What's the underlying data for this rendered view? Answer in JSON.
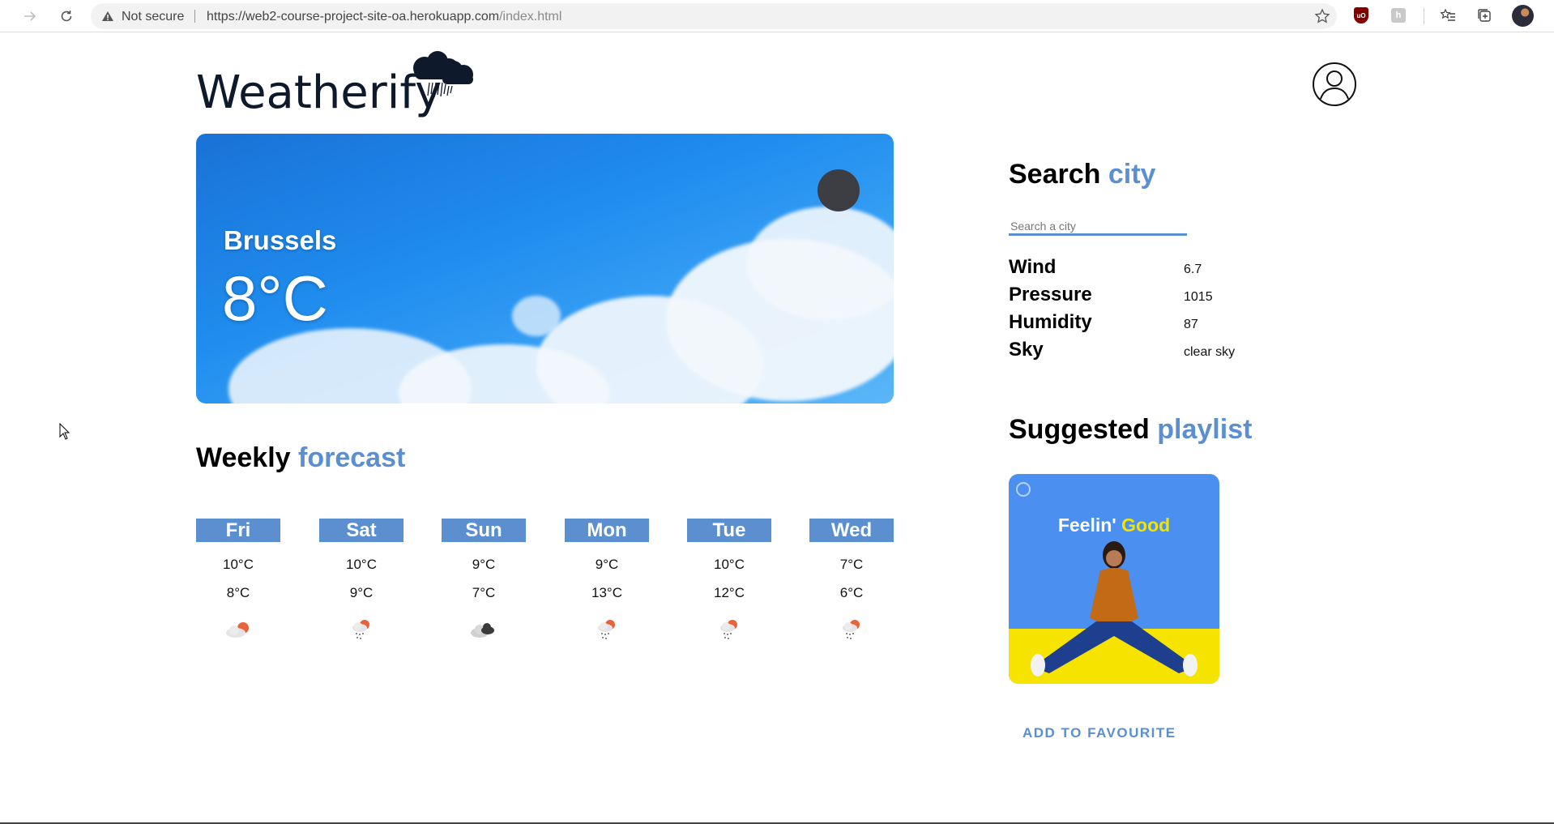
{
  "browser": {
    "security_label": "Not secure",
    "url_host": "https://web2-course-project-site-oa.herokuapp.com",
    "url_path": "/index.html",
    "ublock_badge": "uO",
    "gray_ext_badge": "h"
  },
  "logo": {
    "text": "Weatherify"
  },
  "hero": {
    "city": "Brussels",
    "temperature": "8°C"
  },
  "weekly": {
    "title_main": "Weekly",
    "title_accent": "forecast",
    "days": [
      {
        "day": "Fri",
        "high": "10°C",
        "low": "8°C",
        "icon": "cloud-sun-icon"
      },
      {
        "day": "Sat",
        "high": "10°C",
        "low": "9°C",
        "icon": "cloud-rain-sun-icon"
      },
      {
        "day": "Sun",
        "high": "9°C",
        "low": "7°C",
        "icon": "dark-clouds-icon"
      },
      {
        "day": "Mon",
        "high": "9°C",
        "low": "13°C",
        "icon": "cloud-rain-sun-icon"
      },
      {
        "day": "Tue",
        "high": "10°C",
        "low": "12°C",
        "icon": "cloud-rain-sun-icon"
      },
      {
        "day": "Wed",
        "high": "7°C",
        "low": "6°C",
        "icon": "cloud-rain-sun-icon"
      }
    ]
  },
  "search": {
    "title_main": "Search",
    "title_accent": "city",
    "placeholder": "Search a city"
  },
  "stats": [
    {
      "label": "Wind",
      "value": "6.7"
    },
    {
      "label": "Pressure",
      "value": "1015"
    },
    {
      "label": "Humidity",
      "value": "87"
    },
    {
      "label": "Sky",
      "value": "clear sky"
    }
  ],
  "playlist": {
    "title_main": "Suggested",
    "title_accent": "playlist",
    "name_part1": "Feelin'",
    "name_part2": "Good",
    "button_label": "ADD TO FAVOURITE"
  },
  "colors": {
    "accent": "#5b8fd0",
    "hero_sky": "#1f8cee",
    "playlist_blue": "#4b8ff0",
    "playlist_yellow": "#f7e300"
  }
}
